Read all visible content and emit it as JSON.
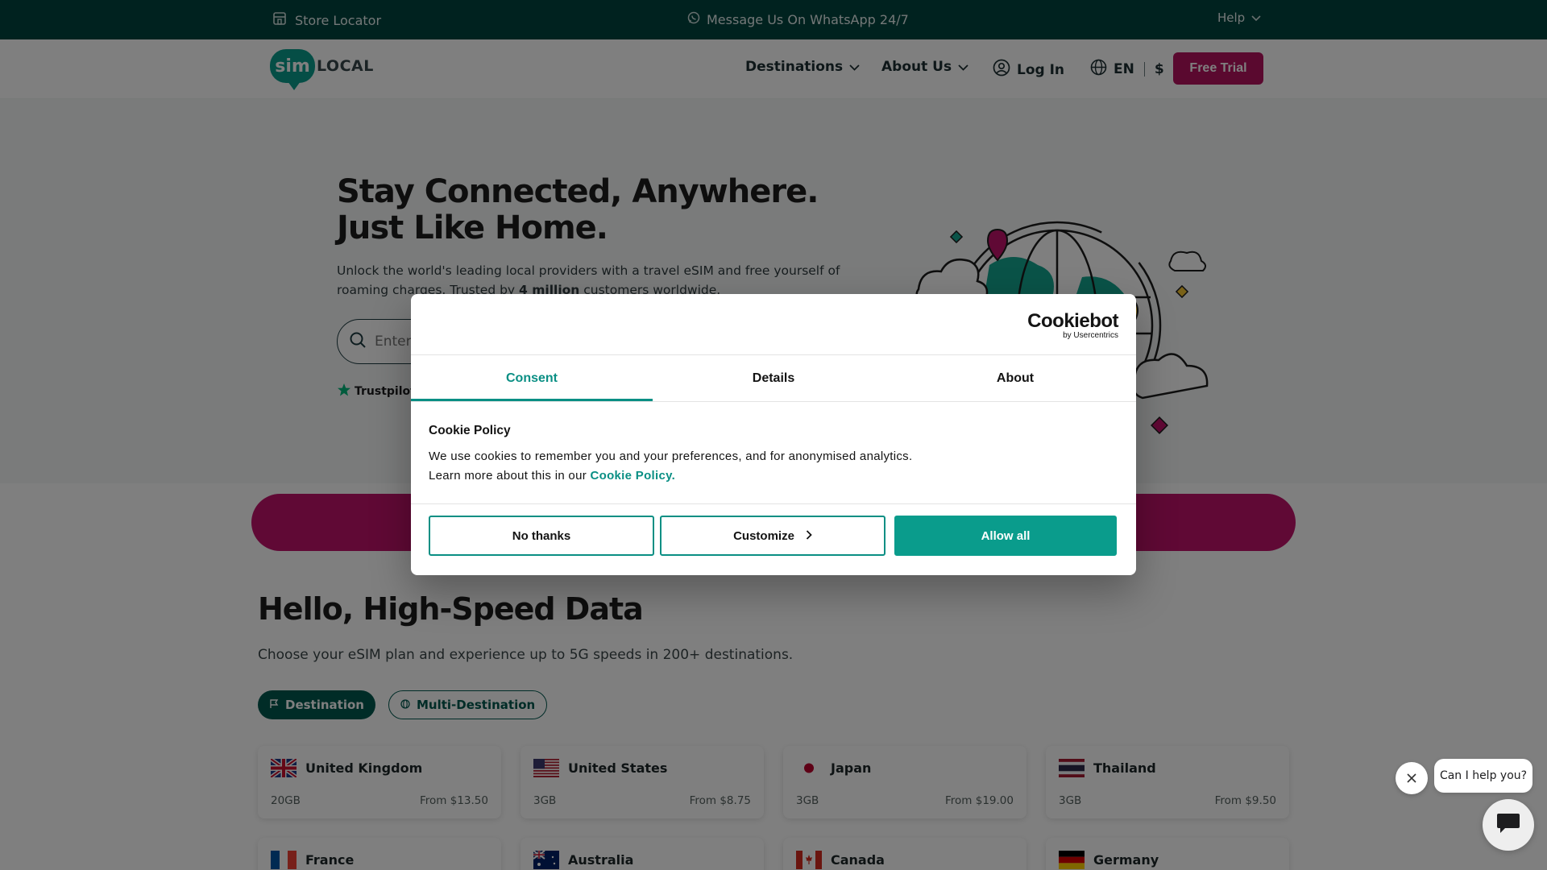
{
  "topbar": {
    "store_locator": "Store Locator",
    "whatsapp": "Message Us On WhatsApp 24/7",
    "help": "Help"
  },
  "header": {
    "logo_sim": "sim",
    "logo_local": "LOCAL",
    "nav": {
      "destinations": "Destinations",
      "about_us": "About Us",
      "log_in": "Log In",
      "language": "EN",
      "currency": "$"
    },
    "free_trial": "Free Trial"
  },
  "hero": {
    "title": "Stay Connected, Anywhere.  Just Like Home.",
    "subtitle_before": "Unlock the world's leading local providers with a travel eSIM and free yourself of roaming charges. Trusted by ",
    "subtitle_bold": "4 million",
    "subtitle_after": " customers worldwide.",
    "search_placeholder": "Enter your destination",
    "trustpilot": "Trustpilot"
  },
  "products": {
    "title": "Hello, High-Speed Data",
    "subtitle": "Choose your eSIM plan and experience up to 5G speeds in 200+ destinations.",
    "tabs": [
      {
        "label": "Destination",
        "active": true
      },
      {
        "label": "Multi-Destination",
        "active": false
      }
    ],
    "cards": [
      {
        "country": "United Kingdom",
        "data": "20GB",
        "price": "From $13.50",
        "flag": "uk-flag"
      },
      {
        "country": "United States",
        "data": "3GB",
        "price": "From $8.75",
        "flag": "us-flag"
      },
      {
        "country": "Japan",
        "data": "3GB",
        "price": "From $19.00",
        "flag": "japan-flag"
      },
      {
        "country": "Thailand",
        "data": "3GB",
        "price": "From $9.50",
        "flag": "thailand-flag"
      },
      {
        "country": "France",
        "data": "",
        "price": "",
        "flag": "france-flag"
      },
      {
        "country": "Australia",
        "data": "",
        "price": "",
        "flag": "australia-flag"
      },
      {
        "country": "Canada",
        "data": "",
        "price": "",
        "flag": "canada-flag"
      },
      {
        "country": "Germany",
        "data": "",
        "price": "",
        "flag": "germany-flag"
      }
    ]
  },
  "cookie_dialog": {
    "brand": "Cookiebot",
    "brand_sub": "by Usercentrics",
    "tabs": [
      "Consent",
      "Details",
      "About"
    ],
    "active_tab": "Consent",
    "title": "Cookie Policy",
    "text_line1": "We use cookies to remember you and your preferences, and for anonymised analytics.",
    "text_line2_before": "Learn more about this in our ",
    "text_link": "Cookie Policy.",
    "buttons": {
      "no_thanks": "No thanks",
      "customize": "Customize",
      "allow_all": "Allow all"
    }
  },
  "chat": {
    "prompt": "Can I help you?"
  },
  "colors": {
    "topbar": "#00443f",
    "brand_teal": "#0a9c8c",
    "brand_magenta": "#b5135f",
    "tab_active": "#00584f"
  }
}
